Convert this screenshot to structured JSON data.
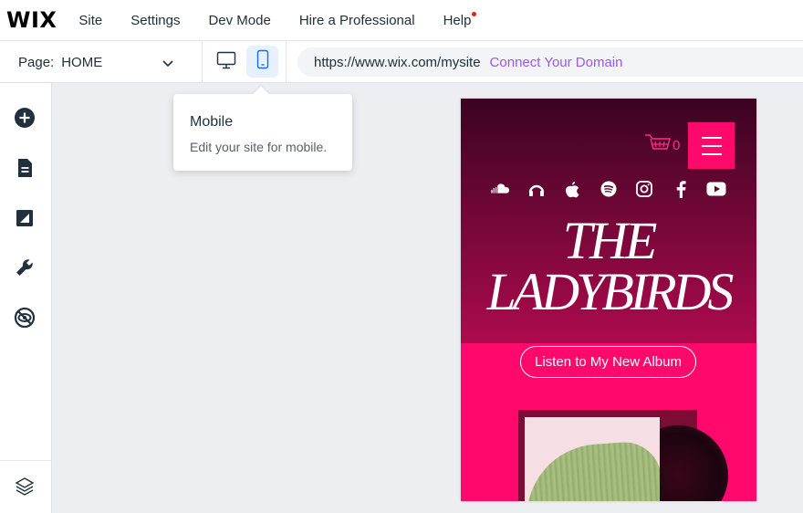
{
  "app": {
    "logo": "WIX"
  },
  "topmenu": {
    "items": [
      {
        "label": "Site"
      },
      {
        "label": "Settings"
      },
      {
        "label": "Dev Mode"
      },
      {
        "label": "Hire a Professional"
      },
      {
        "label": "Help"
      }
    ],
    "help_has_notification": true
  },
  "pagebar": {
    "page_label": "Page:",
    "page_name": "HOME",
    "active_view": "mobile",
    "url": "https://www.wix.com/mysite",
    "connect_domain": "Connect Your Domain"
  },
  "sidebar": {
    "icons": [
      "add-icon",
      "pages-icon",
      "design-icon",
      "tools-icon",
      "hidden-elements-icon",
      "layers-icon"
    ]
  },
  "tooltip": {
    "title": "Mobile",
    "description": "Edit your site for mobile."
  },
  "preview": {
    "cart_count": "0",
    "social_icons": [
      "soundcloud-icon",
      "podcast-icon",
      "apple-icon",
      "spotify-icon",
      "instagram-icon",
      "facebook-icon",
      "youtube-icon"
    ],
    "title_line1": "THE",
    "title_line2": "LADYBIRDS",
    "cta_label": "Listen to My New Album"
  },
  "colors": {
    "accent_purple": "#9a58e8",
    "brand_pink": "#ff0a6c",
    "hero_dark": "#3a0320",
    "mobile_active_bg": "#e7f0ff"
  }
}
